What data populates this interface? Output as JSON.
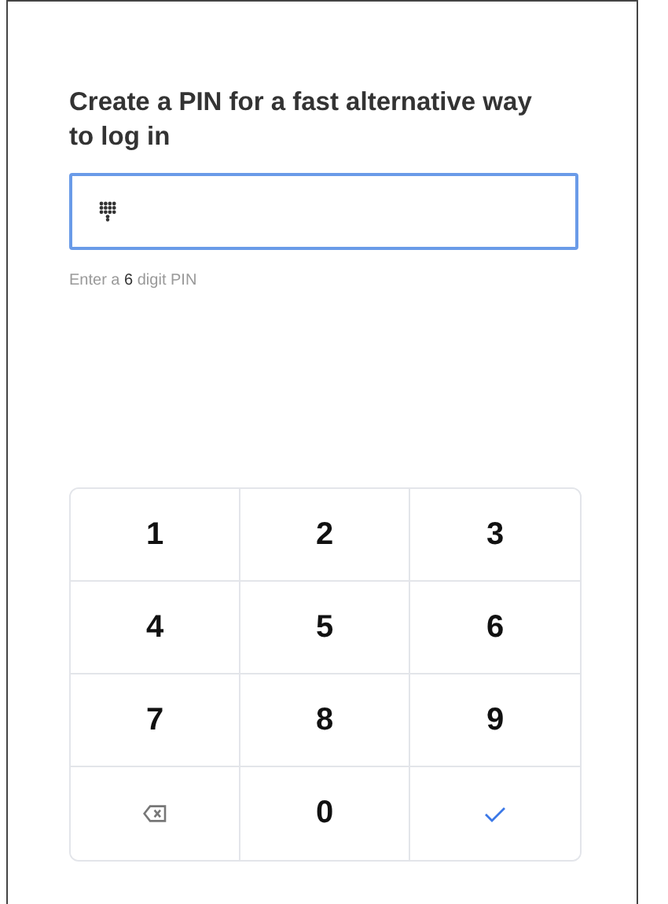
{
  "title": "Create a PIN for a fast alternative way to log in",
  "hint": {
    "before": "Enter a",
    "count": "6",
    "after": "digit PIN"
  },
  "keypad": [
    {
      "kind": "digit",
      "label": "1"
    },
    {
      "kind": "digit",
      "label": "2"
    },
    {
      "kind": "digit",
      "label": "3"
    },
    {
      "kind": "digit",
      "label": "4"
    },
    {
      "kind": "digit",
      "label": "5"
    },
    {
      "kind": "digit",
      "label": "6"
    },
    {
      "kind": "digit",
      "label": "7"
    },
    {
      "kind": "digit",
      "label": "8"
    },
    {
      "kind": "digit",
      "label": "9"
    },
    {
      "kind": "backspace"
    },
    {
      "kind": "digit",
      "label": "0"
    },
    {
      "kind": "confirm"
    }
  ]
}
